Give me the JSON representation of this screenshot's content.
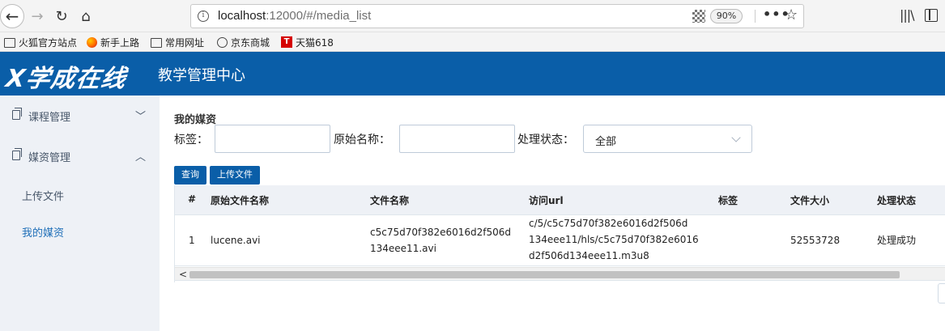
{
  "browser": {
    "url_host": "localhost",
    "url_rest": ":12000/#/media_list",
    "zoom": "90%",
    "more": "•••",
    "info": "i",
    "bookmarks": [
      "火狐官方站点",
      "新手上路",
      "常用网址",
      "京东商城",
      "天猫618"
    ],
    "tmall_logo": "T"
  },
  "app": {
    "logo": "学成在线",
    "logo_mark": "X",
    "subtitle": "教学管理中心"
  },
  "sidebar": {
    "groups": [
      {
        "label": "课程管理",
        "chevron": "﹀"
      },
      {
        "label": "媒资管理",
        "chevron": "︿"
      }
    ],
    "items": [
      {
        "label": "上传文件"
      },
      {
        "label": "我的媒资"
      }
    ]
  },
  "main": {
    "title": "我的媒资",
    "filters": {
      "tag_label": "标签：",
      "name_label": "原始名称：",
      "status_label": "处理状态：",
      "status_value": "全部"
    },
    "buttons": {
      "query": "查询",
      "upload": "上传文件"
    },
    "table": {
      "headers": [
        "#",
        "原始文件名称",
        "文件名称",
        "访问url",
        "标签",
        "文件大小",
        "处理状态"
      ],
      "rows": [
        {
          "index": "1",
          "original_name": "lucene.avi",
          "file_name_1": "c5c75d70f382e6016d2f506d",
          "file_name_2": "134eee11.avi",
          "url_1": "c/5/c5c75d70f382e6016d2f506d",
          "url_2": "134eee11/hls/c5c75d70f382e6016",
          "url_3": "d2f506d134eee11.m3u8",
          "tag": "",
          "size": "52553728",
          "status": "处理成功"
        }
      ]
    },
    "scroll_left": "<"
  }
}
